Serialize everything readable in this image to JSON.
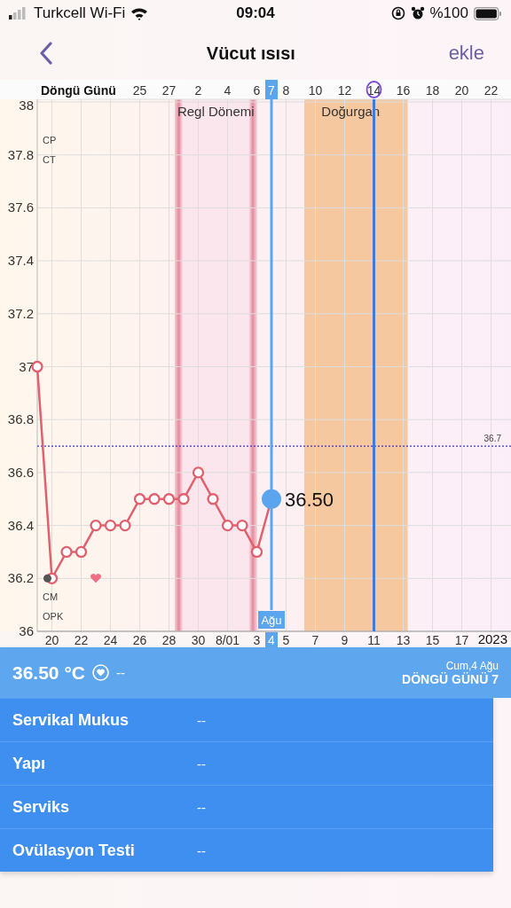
{
  "status_bar": {
    "carrier": "Turkcell Wi-Fi",
    "time": "09:04",
    "battery": "%100"
  },
  "nav": {
    "title": "Vücut ısısı",
    "action": "ekle"
  },
  "chart": {
    "axis_label": "Döngü Günü",
    "cycle_days": [
      {
        "label": "25",
        "selected": false,
        "circled": false
      },
      {
        "label": "27",
        "selected": false,
        "circled": false
      },
      {
        "label": "2",
        "selected": false,
        "circled": false
      },
      {
        "label": "4",
        "selected": false,
        "circled": false
      },
      {
        "label": "6",
        "selected": false,
        "circled": false
      },
      {
        "label": "7",
        "selected": true,
        "circled": false
      },
      {
        "label": "8",
        "selected": false,
        "circled": false
      },
      {
        "label": "10",
        "selected": false,
        "circled": false
      },
      {
        "label": "12",
        "selected": false,
        "circled": false
      },
      {
        "label": "14",
        "selected": false,
        "circled": true
      },
      {
        "label": "16",
        "selected": false,
        "circled": false
      },
      {
        "label": "18",
        "selected": false,
        "circled": false
      },
      {
        "label": "20",
        "selected": false,
        "circled": false
      },
      {
        "label": "22",
        "selected": false,
        "circled": false
      }
    ],
    "zones": [
      {
        "kind": "period",
        "label": "Regl Dönemi",
        "color": "#fbe6ee"
      },
      {
        "kind": "fertile",
        "label": "Doğurgan",
        "color": "#f5c8a0"
      }
    ],
    "side_labels": [
      {
        "kind": "top",
        "label": "CP"
      },
      {
        "kind": "top",
        "label": "CT"
      },
      {
        "kind": "bottom",
        "label": "CM"
      },
      {
        "kind": "bottom",
        "label": "OPK"
      }
    ],
    "selected_value": "36.50",
    "selected_month": "Ağu",
    "year": "2023",
    "chart_data": {
      "type": "line",
      "grid": true,
      "categories": [
        null,
        "20",
        null,
        "22",
        null,
        "24",
        null,
        "26",
        null,
        "28",
        null,
        "30",
        null,
        "8/01",
        null,
        "3",
        "4",
        "5",
        null,
        "7",
        null,
        "9",
        null,
        "11",
        null,
        "13",
        null,
        "15",
        null,
        "17",
        null,
        null,
        null
      ],
      "series": [
        {
          "color": "#e0606e",
          "marker": "circle",
          "values": [
            37.0,
            36.2,
            36.3,
            36.3,
            36.4,
            36.4,
            36.4,
            36.5,
            36.5,
            36.5,
            36.5,
            36.6,
            36.5,
            36.4,
            36.4,
            36.3,
            36.5,
            null,
            null,
            null,
            null,
            null,
            null,
            null,
            null,
            null,
            null,
            null,
            null,
            null,
            null,
            null,
            null
          ]
        }
      ],
      "ylim": [
        36,
        38
      ],
      "yticks": [
        36,
        36.2,
        36.4,
        36.6,
        36.8,
        37,
        37.2,
        37.4,
        37.6,
        37.8,
        38
      ],
      "ref_lines": [
        {
          "axis": "y",
          "value": 36.7,
          "label": "36.7",
          "color": "#3535c0"
        },
        {
          "axis": "x",
          "value": "11",
          "color": "#3b7ddd"
        }
      ]
    }
  },
  "summary": {
    "temperature": "36.50 °C",
    "note": "--",
    "date": "Cum,4 Ağu",
    "cycle_day": "DÖNGÜ GÜNÜ 7"
  },
  "rows": [
    {
      "label": "Servikal Mukus",
      "value": "--"
    },
    {
      "label": "Yapı",
      "value": "--"
    },
    {
      "label": "Serviks",
      "value": "--"
    },
    {
      "label": "Ovülasyon Testi",
      "value": "--"
    }
  ]
}
